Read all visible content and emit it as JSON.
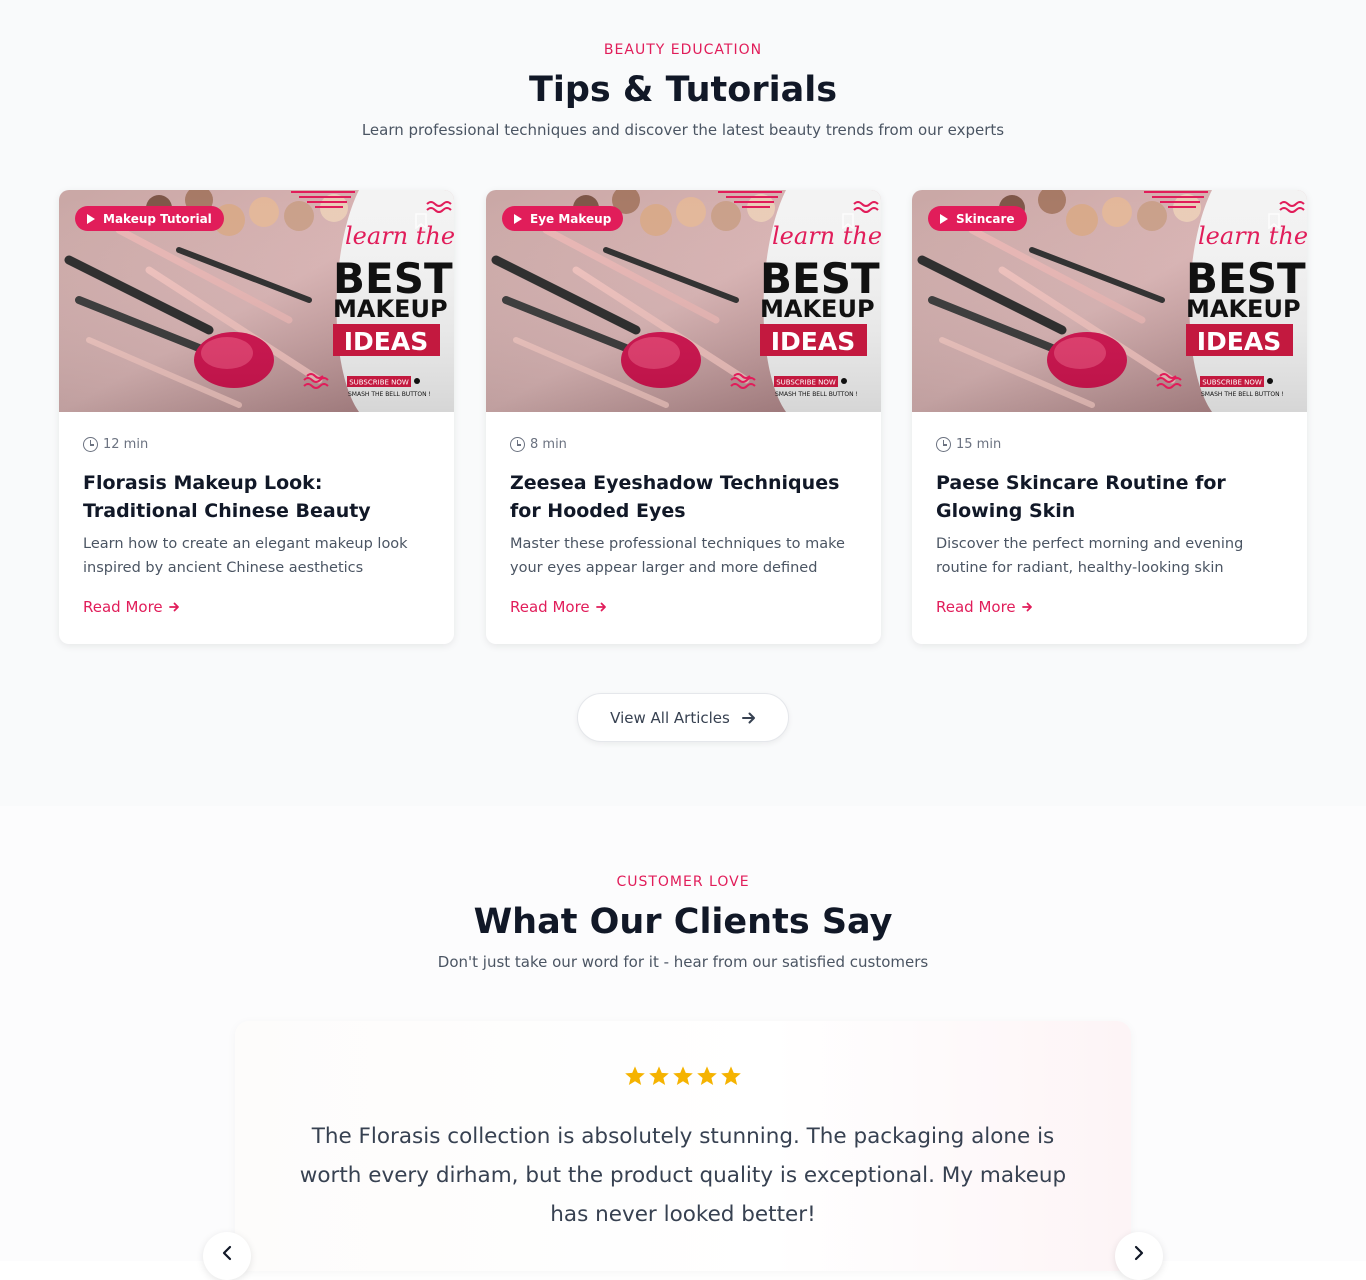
{
  "tips": {
    "eyebrow": "BEAUTY EDUCATION",
    "heading": "Tips & Tutorials",
    "subheading": "Learn professional techniques and discover the latest beauty trends from our experts",
    "cards": [
      {
        "badge": "Makeup Tutorial",
        "image_text": {
          "line1": "learn the",
          "line2": "BEST",
          "line3": "MAKEUP",
          "line4": "IDEAS",
          "cta": "SUBSCRIBE NOW",
          "cta_sub": "SMASH THE BELL BUTTON !"
        },
        "duration": "12 min",
        "title": "Florasis Makeup Look: Traditional Chinese Beauty",
        "description": "Learn how to create an elegant makeup look inspired by ancient Chinese aesthetics",
        "link": "Read More"
      },
      {
        "badge": "Eye Makeup",
        "image_text": {
          "line1": "learn the",
          "line2": "BEST",
          "line3": "MAKEUP",
          "line4": "IDEAS",
          "cta": "SUBSCRIBE NOW",
          "cta_sub": "SMASH THE BELL BUTTON !"
        },
        "duration": "8 min",
        "title": "Zeesea Eyeshadow Techniques for Hooded Eyes",
        "description": "Master these professional techniques to make your eyes appear larger and more defined",
        "link": "Read More"
      },
      {
        "badge": "Skincare",
        "image_text": {
          "line1": "learn the",
          "line2": "BEST",
          "line3": "MAKEUP",
          "line4": "IDEAS",
          "cta": "SUBSCRIBE NOW",
          "cta_sub": "SMASH THE BELL BUTTON !"
        },
        "duration": "15 min",
        "title": "Paese Skincare Routine for Glowing Skin",
        "description": "Discover the perfect morning and evening routine for radiant, healthy-looking skin",
        "link": "Read More"
      }
    ],
    "view_all": "View All Articles"
  },
  "testimonials": {
    "eyebrow": "CUSTOMER LOVE",
    "heading": "What Our Clients Say",
    "subheading": "Don't just take our word for it - hear from our satisfied customers",
    "rating": 5,
    "quote": "The Florasis collection is absolutely stunning. The packaging alone is worth every dirham, but the product quality is exceptional. My makeup has never looked better!",
    "prev_icon": "chevron-left-icon",
    "next_icon": "chevron-right-icon"
  },
  "colors": {
    "accent": "#e11d5a",
    "star": "#f5b301",
    "heading": "#111827",
    "body": "#4b5563"
  }
}
